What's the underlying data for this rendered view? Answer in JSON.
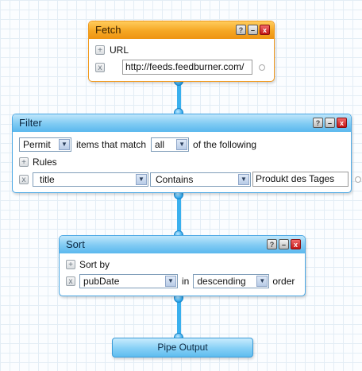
{
  "fetch": {
    "title": "Fetch",
    "url_label": "URL",
    "url_value": "http://feeds.feedburner.com/"
  },
  "filter": {
    "title": "Filter",
    "mode": "Permit",
    "items_that_match": "items that match",
    "match": "all",
    "of_the_following": "of the following",
    "rules_label": "Rules",
    "rule_field": "title",
    "rule_operator": "Contains",
    "rule_value": "Produkt des Tages"
  },
  "sort": {
    "title": "Sort",
    "sort_by_label": "Sort by",
    "field": "pubDate",
    "in_label": "in",
    "direction": "descending",
    "order_label": "order"
  },
  "output": {
    "title": "Pipe Output"
  },
  "window_buttons": {
    "help": "?",
    "minimize": "–",
    "close": "x"
  },
  "icons": {
    "add": "+",
    "remove": "x",
    "dropdown": "▼"
  }
}
